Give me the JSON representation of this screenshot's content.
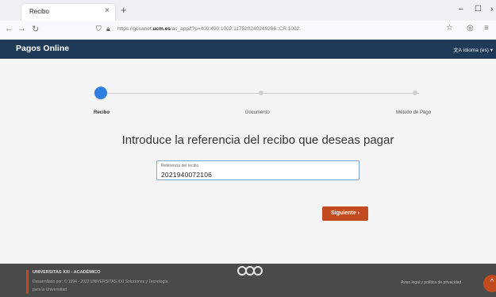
{
  "browser": {
    "tab_title": "Recibo",
    "tab_close": "×",
    "new_tab": "+",
    "win_min": "–",
    "win_max": "☐",
    "url_prefix": "https://",
    "url_host_prefix": "gesanet.",
    "url_host_bold": "ucm.es",
    "url_rest": "/ac_app/f?p=400:400:1002:117520240249266::CR:1002:",
    "icons": [
      "back-icon",
      "forward-icon",
      "reload-icon",
      "shield-tracking-icon",
      "lock-icon",
      "star-icon",
      "pocket-icon",
      "menu-icon"
    ]
  },
  "header": {
    "title": "Pagos Online",
    "language": "Idioma (es)"
  },
  "stepper": {
    "steps": [
      {
        "label": "Recibo",
        "active": true
      },
      {
        "label": "Documento",
        "active": false
      },
      {
        "label": "Método de Pago",
        "active": false
      }
    ]
  },
  "form": {
    "heading": "Introduce la referencia del recibo que deseas pagar",
    "field_label": "Referencia del recibo",
    "field_value": "2021940072106",
    "next_button": "Siguiente",
    "next_chevron": "›"
  },
  "footer": {
    "brand": "UNIVERSITAS XXI - ACADÉMICO",
    "developed_by": "Desarrollado por: © 1994 - 2022 UNIVERSITAS XXI Soluciones y Tecnología",
    "subline": "para la Universidad",
    "legal": "Aviso legal y política de privacidad",
    "scroll_top": "^"
  },
  "colors": {
    "header_bg": "#1f3a57",
    "accent": "#c14a1f",
    "step_active": "#2f80e0",
    "footer_bg": "#4a4a4a"
  }
}
